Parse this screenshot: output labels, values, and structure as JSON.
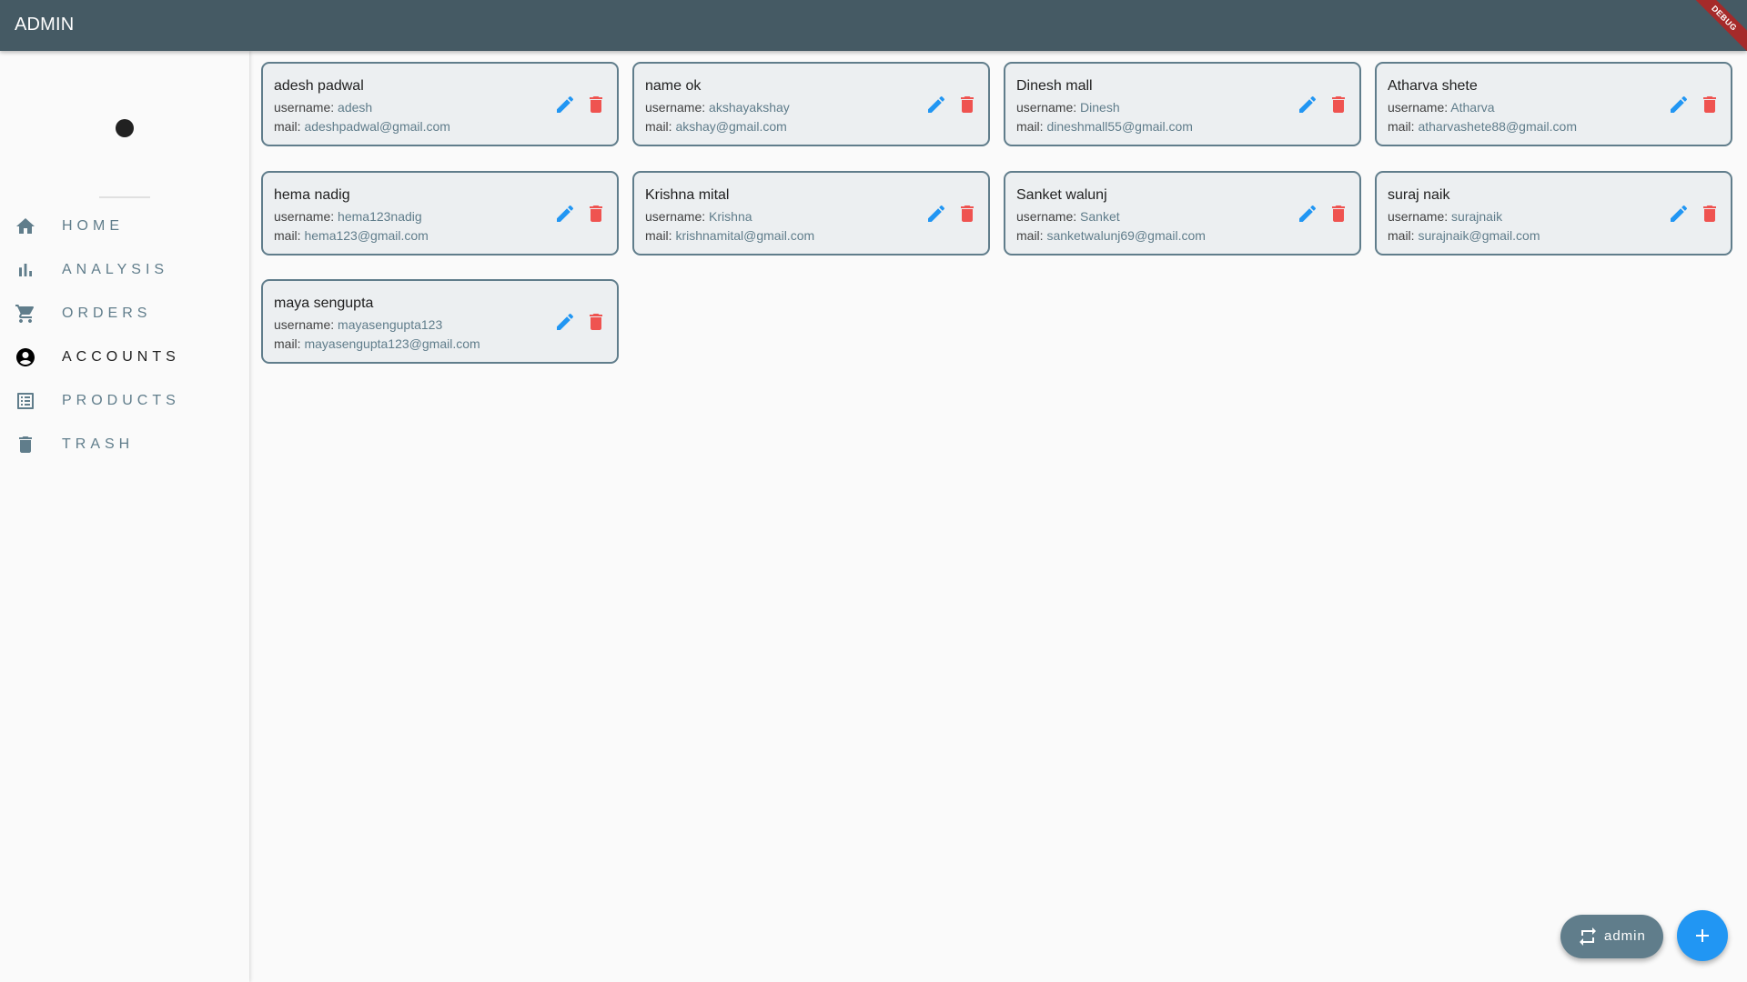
{
  "appbar": {
    "title": "ADMIN",
    "debug_banner": "DEBUG"
  },
  "sidebar": {
    "items": [
      {
        "label": "HOME",
        "icon": "home-icon",
        "active": false
      },
      {
        "label": "ANALYSIS",
        "icon": "bar-chart-icon",
        "active": false
      },
      {
        "label": "ORDERS",
        "icon": "shopping-cart-icon",
        "active": false
      },
      {
        "label": "ACCOUNTS",
        "icon": "account-circle-icon",
        "active": true
      },
      {
        "label": "PRODUCTS",
        "icon": "list-alt-icon",
        "active": false
      },
      {
        "label": "TRASH",
        "icon": "trash-icon",
        "active": false
      }
    ]
  },
  "accounts": {
    "username_label": "username: ",
    "mail_label": "mail: ",
    "cards": [
      {
        "name": "adesh padwal",
        "username": "adesh",
        "mail": "adeshpadwal@gmail.com"
      },
      {
        "name": "name ok",
        "username": "akshayakshay",
        "mail": "akshay@gmail.com"
      },
      {
        "name": "Dinesh mall",
        "username": "Dinesh",
        "mail": "dineshmall55@gmail.com"
      },
      {
        "name": "Atharva shete",
        "username": "Atharva",
        "mail": "atharvashete88@gmail.com"
      },
      {
        "name": "hema nadig",
        "username": "hema123nadig",
        "mail": "hema123@gmail.com"
      },
      {
        "name": "Krishna mital",
        "username": "Krishna",
        "mail": "krishnamital@gmail.com"
      },
      {
        "name": "Sanket walunj",
        "username": "Sanket",
        "mail": "sanketwalunj69@gmail.com"
      },
      {
        "name": "suraj naik",
        "username": "surajnaik",
        "mail": "surajnaik@gmail.com"
      },
      {
        "name": "maya sengupta",
        "username": "mayasengupta123",
        "mail": "mayasengupta123@gmail.com"
      }
    ]
  },
  "actions": {
    "switch_user_label": "admin",
    "add_icon": "plus-icon",
    "switch_icon": "repeat-icon"
  },
  "colors": {
    "appbar": "#455a64",
    "accent": "#2196f3",
    "danger": "#ef5350",
    "slate": "#607d8b",
    "card_bg": "#eceff1"
  }
}
